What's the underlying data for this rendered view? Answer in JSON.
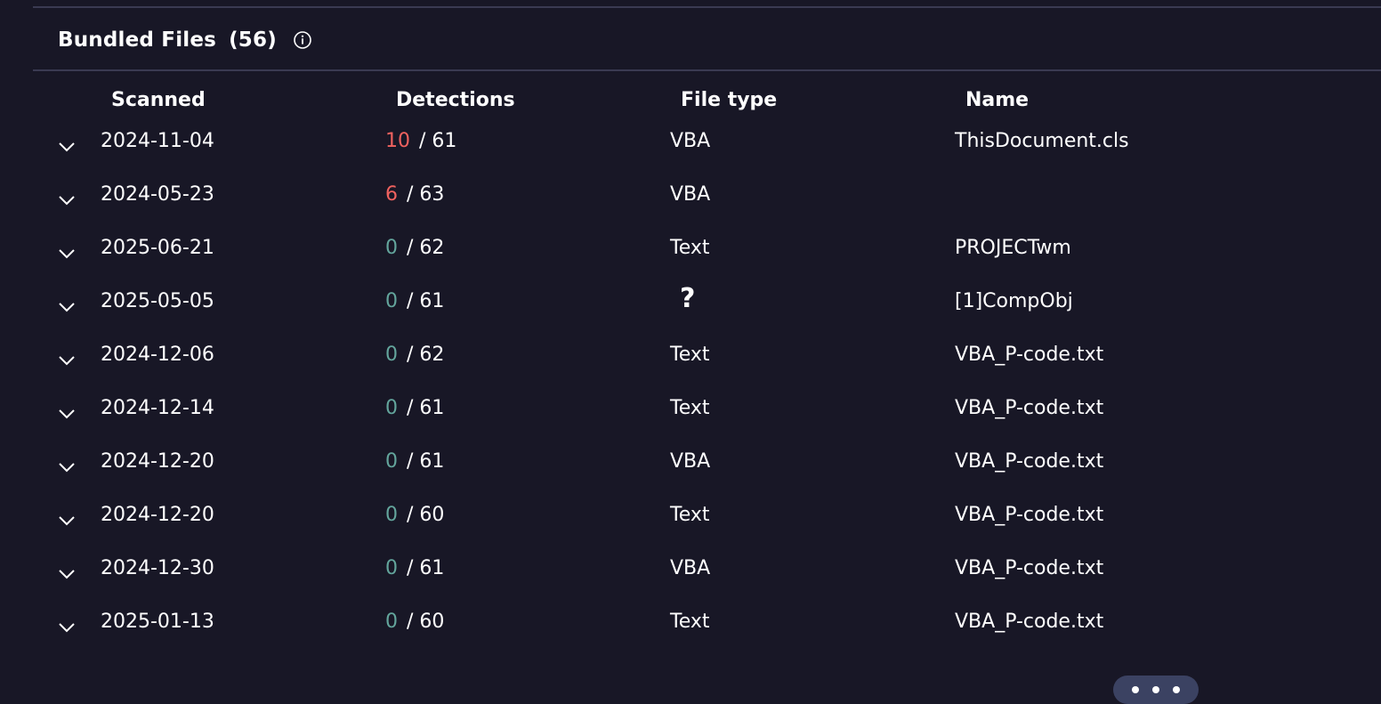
{
  "section": {
    "title": "Bundled Files",
    "count": "(56)",
    "info_icon": "info-circle-icon"
  },
  "columns": {
    "scanned": "Scanned",
    "detections": "Detections",
    "file_type": "File type",
    "name": "Name"
  },
  "colors": {
    "background": "#181726",
    "detection_positive": "#f0625f",
    "detection_zero": "#63a59c",
    "more_button": "#3b4262"
  },
  "rows": [
    {
      "scanned": "2024-11-04",
      "detected": "10",
      "total": "61",
      "file_type": "VBA",
      "name": "ThisDocument.cls",
      "flag": "pos"
    },
    {
      "scanned": "2024-05-23",
      "detected": "6",
      "total": "63",
      "file_type": "VBA",
      "name": "",
      "flag": "pos"
    },
    {
      "scanned": "2025-06-21",
      "detected": "0",
      "total": "62",
      "file_type": "Text",
      "name": "PROJECTwm",
      "flag": "zero"
    },
    {
      "scanned": "2025-05-05",
      "detected": "0",
      "total": "61",
      "file_type": "?",
      "name": "[1]CompObj",
      "flag": "zero"
    },
    {
      "scanned": "2024-12-06",
      "detected": "0",
      "total": "62",
      "file_type": "Text",
      "name": "VBA_P-code.txt",
      "flag": "zero"
    },
    {
      "scanned": "2024-12-14",
      "detected": "0",
      "total": "61",
      "file_type": "Text",
      "name": "VBA_P-code.txt",
      "flag": "zero"
    },
    {
      "scanned": "2024-12-20",
      "detected": "0",
      "total": "61",
      "file_type": "VBA",
      "name": "VBA_P-code.txt",
      "flag": "zero"
    },
    {
      "scanned": "2024-12-20",
      "detected": "0",
      "total": "60",
      "file_type": "Text",
      "name": "VBA_P-code.txt",
      "flag": "zero"
    },
    {
      "scanned": "2024-12-30",
      "detected": "0",
      "total": "61",
      "file_type": "VBA",
      "name": "VBA_P-code.txt",
      "flag": "zero"
    },
    {
      "scanned": "2025-01-13",
      "detected": "0",
      "total": "60",
      "file_type": "Text",
      "name": "VBA_P-code.txt",
      "flag": "zero"
    }
  ],
  "more_button_icon": "more-horizontal-icon"
}
